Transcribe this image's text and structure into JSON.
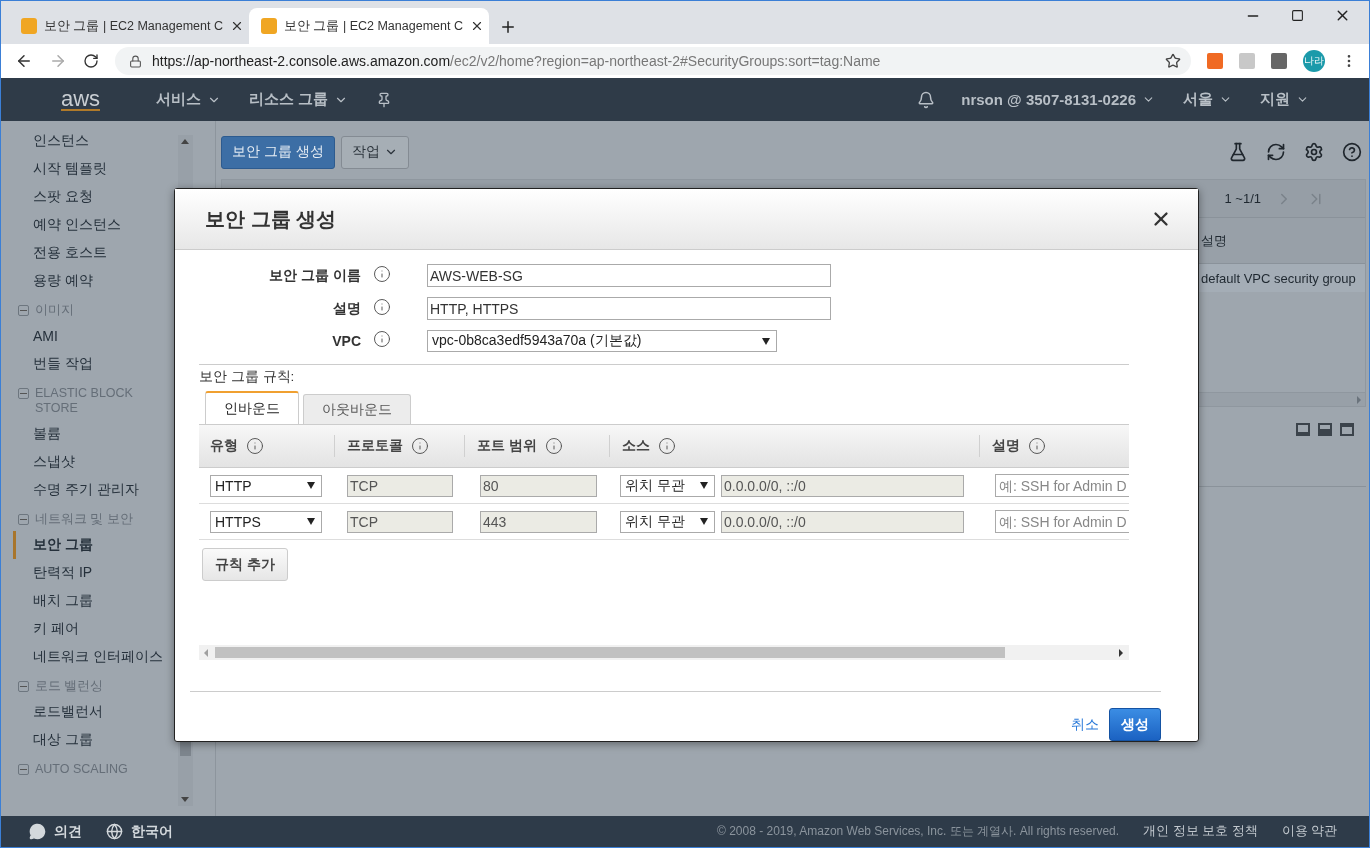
{
  "browser": {
    "tabs": [
      {
        "title": "보안 그룹 | EC2 Management C",
        "selected": false
      },
      {
        "title": "보안 그룹 | EC2 Management C",
        "selected": true
      }
    ],
    "url_host": "https://ap-northeast-2.console.aws.amazon.com",
    "url_rest": "/ec2/v2/home?region=ap-northeast-2#SecurityGroups:sort=tag:Name",
    "avatar": "나라"
  },
  "console_nav": {
    "logo": "aws",
    "menus": [
      "서비스",
      "리소스 그룹"
    ],
    "account": "nrson @ 3507-8131-0226",
    "region": "서울",
    "support": "지원"
  },
  "sidebar": {
    "sections": [
      {
        "items": [
          {
            "label": "인스턴스",
            "selected": false
          },
          {
            "label": "시작 템플릿",
            "selected": false
          },
          {
            "label": "스팟 요청",
            "selected": false
          },
          {
            "label": "예약 인스턴스",
            "selected": false
          },
          {
            "label": "전용 호스트",
            "selected": false
          },
          {
            "label": "용량 예약",
            "selected": false
          }
        ]
      },
      {
        "header": "이미지",
        "items": [
          {
            "label": "AMI",
            "selected": false
          },
          {
            "label": "번들 작업",
            "selected": false
          }
        ]
      },
      {
        "header": "ELASTIC BLOCK STORE",
        "items": [
          {
            "label": "볼륨",
            "selected": false
          },
          {
            "label": "스냅샷",
            "selected": false
          },
          {
            "label": "수명 주기 관리자",
            "selected": false
          }
        ]
      },
      {
        "header": "네트워크 및 보안",
        "items": [
          {
            "label": "보안 그룹",
            "selected": true
          },
          {
            "label": "탄력적 IP",
            "selected": false
          },
          {
            "label": "배치 그룹",
            "selected": false
          },
          {
            "label": "키 페어",
            "selected": false
          },
          {
            "label": "네트워크 인터페이스",
            "selected": false
          }
        ]
      },
      {
        "header": "로드 밸런싱",
        "items": [
          {
            "label": "로드밸런서",
            "selected": false
          },
          {
            "label": "대상 그룹",
            "selected": false
          }
        ]
      },
      {
        "header": "AUTO SCALING"
      }
    ]
  },
  "content": {
    "create_button": "보안 그룹 생성",
    "actions_button": "작업",
    "pagination": "1 ~1/1",
    "column": "설명",
    "row": "default VPC security group"
  },
  "modal": {
    "title": "보안 그룹 생성",
    "fields": [
      {
        "label": "보안 그룹 이름",
        "value": "AWS-WEB-SG",
        "kind": "text"
      },
      {
        "label": "설명",
        "value": "HTTP, HTTPS",
        "kind": "text"
      },
      {
        "label": "VPC",
        "value": "vpc-0b8ca3edf5943a70a (기본값)",
        "kind": "select"
      }
    ],
    "rules_label": "보안 그룹 규칙:",
    "tabs": [
      {
        "label": "인바운드",
        "selected": true
      },
      {
        "label": "아웃바운드",
        "selected": false
      }
    ],
    "columns": [
      "유형",
      "프로토콜",
      "포트 범위",
      "소스",
      "설명"
    ],
    "rules": [
      {
        "type": "HTTP",
        "protocol": "TCP",
        "port": "80",
        "source": "위치 무관",
        "cidr": "0.0.0.0/0, ::/0",
        "placeholder": "예: SSH for Admin D"
      },
      {
        "type": "HTTPS",
        "protocol": "TCP",
        "port": "443",
        "source": "위치 무관",
        "cidr": "0.0.0.0/0, ::/0",
        "placeholder": "예: SSH for Admin D"
      }
    ],
    "add_rule": "규칙 추가",
    "cancel": "취소",
    "create": "생성"
  },
  "footer": {
    "feedback": "의견",
    "language": "한국어",
    "copyright": "© 2008 - 2019, Amazon Web Services, Inc. 또는 계열사. All rights reserved.",
    "privacy": "개인 정보 보호 정책",
    "terms": "이용 약관"
  }
}
